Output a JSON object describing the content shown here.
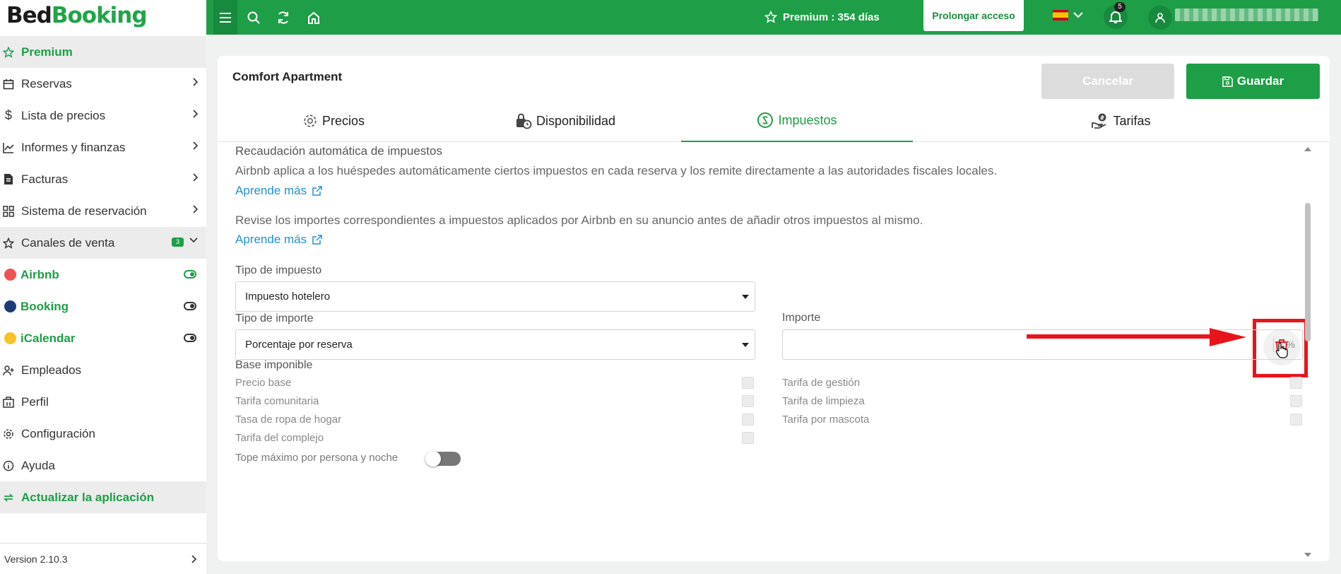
{
  "app": {
    "logo_part1": "Bed",
    "logo_part2": "Booking"
  },
  "topbar": {
    "premium_label": "Premium : ",
    "premium_days": "354 días",
    "prolong_button": "Prolongar acceso",
    "notifications_count": "5"
  },
  "sidebar": {
    "items": [
      {
        "label": "Premium"
      },
      {
        "label": "Reservas"
      },
      {
        "label": "Lista de precios"
      },
      {
        "label": "Informes y finanzas"
      },
      {
        "label": "Facturas"
      },
      {
        "label": "Sistema de reservación"
      },
      {
        "label": "Canales de venta",
        "badge": "3"
      },
      {
        "label": "Airbnb",
        "color": "#f05252"
      },
      {
        "label": "Booking",
        "color": "#1e3a7a"
      },
      {
        "label": "iCalendar",
        "color": "#f7c325"
      },
      {
        "label": "Empleados"
      },
      {
        "label": "Perfil"
      },
      {
        "label": "Configuración"
      },
      {
        "label": "Ayuda"
      },
      {
        "label": "Actualizar la aplicación"
      }
    ],
    "version": "Version 2.10.3"
  },
  "main": {
    "title": "Comfort Apartment",
    "cancel_button": "Cancelar",
    "save_button": "Guardar",
    "tabs": [
      {
        "label": "Precios"
      },
      {
        "label": "Disponibilidad"
      },
      {
        "label": "Impuestos",
        "active": true
      },
      {
        "label": "Tarifas"
      }
    ],
    "section_title": "Recaudación automática de impuestos",
    "para1": "Airbnb aplica a los huéspedes automáticamente ciertos impuestos en cada reserva y los remite directamente a las autoridades fiscales locales.",
    "learn_more_1": "Aprende más",
    "para2": "Revise los importes correspondientes a impuestos aplicados por Airbnb en su anuncio antes de añadir otros impuestos al mismo.",
    "learn_more_2": "Aprende más",
    "tax_type_label": "Tipo de impuesto",
    "tax_type_value": "Impuesto hotelero",
    "amount_type_label": "Tipo de importe",
    "amount_type_value": "Porcentaje por reserva",
    "amount_label": "Importe",
    "amount_unit": "%",
    "base_label": "Base imponible",
    "base_items_left": [
      "Precio base",
      "Tarifa comunitaria",
      "Tasa de ropa de hogar",
      "Tarifa del complejo"
    ],
    "base_items_right": [
      "Tarifa de gestión",
      "Tarifa de limpieza",
      "Tarifa por mascota"
    ],
    "max_cap_label": "Tope máximo por persona y noche"
  },
  "colors": {
    "brand": "#1e9e47",
    "annotation": "#e8141c",
    "link": "#2391ce"
  }
}
